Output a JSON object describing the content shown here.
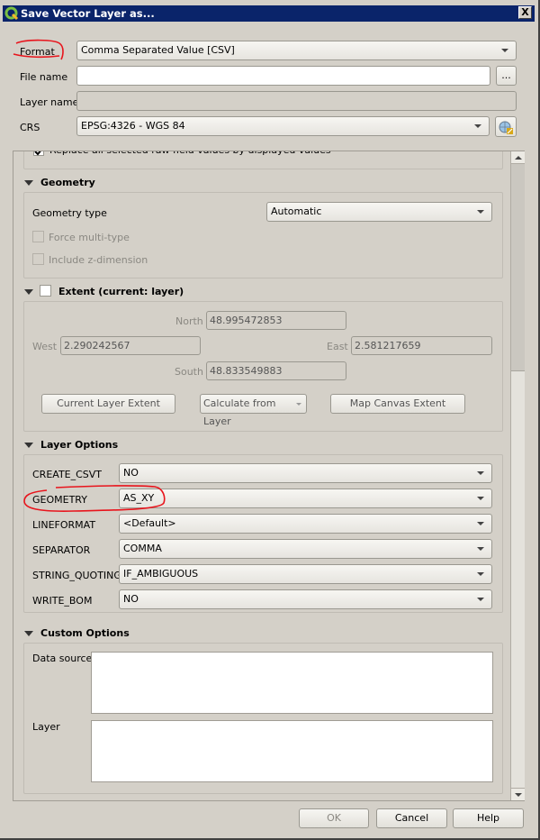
{
  "window": {
    "title": "Save Vector Layer as...",
    "close_label": "X",
    "app_icon": "qgis-logo-icon"
  },
  "form": {
    "format": {
      "label": "Format",
      "value": "Comma Separated Value [CSV]"
    },
    "file_name": {
      "label": "File name",
      "value": "",
      "browse_label": "..."
    },
    "layer_name": {
      "label": "Layer name",
      "value": ""
    },
    "crs": {
      "label": "CRS",
      "value": "EPSG:4326 - WGS 84",
      "select_icon": "crs-select-icon"
    }
  },
  "partial_row": {
    "checked": true,
    "label": "Replace all selected raw field values by displayed values"
  },
  "geometry": {
    "title": "Geometry",
    "type_label": "Geometry type",
    "type_value": "Automatic",
    "force_multi": {
      "label": "Force multi-type",
      "checked": false,
      "enabled": false
    },
    "include_z": {
      "label": "Include z-dimension",
      "checked": false,
      "enabled": false
    }
  },
  "extent": {
    "title": "Extent (current: layer)",
    "checked": false,
    "north": {
      "label": "North",
      "value": "48.995472853"
    },
    "west": {
      "label": "West",
      "value": "2.290242567"
    },
    "east": {
      "label": "East",
      "value": "2.581217659"
    },
    "south": {
      "label": "South",
      "value": "48.833549883"
    },
    "buttons": {
      "current_layer": "Current Layer Extent",
      "calculate_from_layer": "Calculate from Layer",
      "map_canvas": "Map Canvas Extent"
    }
  },
  "layer_options": {
    "title": "Layer Options",
    "rows": [
      {
        "label": "CREATE_CSVT",
        "value": "NO"
      },
      {
        "label": "GEOMETRY",
        "value": "AS_XY"
      },
      {
        "label": "LINEFORMAT",
        "value": "<Default>"
      },
      {
        "label": "SEPARATOR",
        "value": "COMMA"
      },
      {
        "label": "STRING_QUOTING",
        "value": "IF_AMBIGUOUS"
      },
      {
        "label": "WRITE_BOM",
        "value": "NO"
      }
    ]
  },
  "custom_options": {
    "title": "Custom Options",
    "data_source_label": "Data source",
    "data_source_value": "",
    "layer_label": "Layer",
    "layer_value": ""
  },
  "footer": {
    "ok": "OK",
    "cancel": "Cancel",
    "help": "Help"
  },
  "annotations": {
    "color": "#e8141c",
    "highlighted": [
      "Format",
      "GEOMETRY"
    ]
  }
}
